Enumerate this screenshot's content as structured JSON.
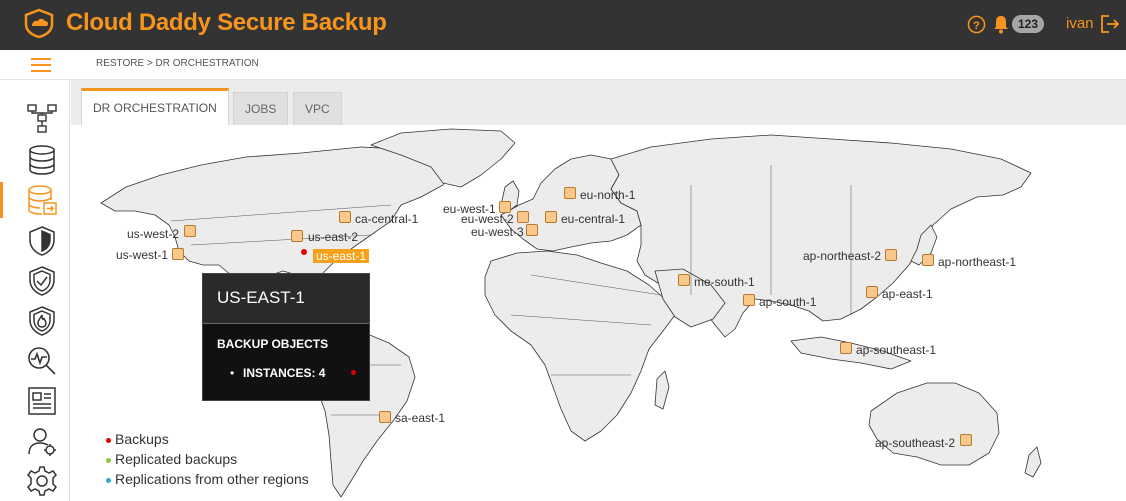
{
  "app": {
    "title": "Cloud Daddy Secure Backup",
    "accent_color": "#f7941d",
    "header_bg": "#333333"
  },
  "header": {
    "help_icon": "help-circle-icon",
    "bell_icon": "bell-icon",
    "notification_count": "123",
    "username": "ivan",
    "logout_icon": "logout-icon"
  },
  "breadcrumb": "RESTORE > DR ORCHESTRATION",
  "sidebar": {
    "items": [
      {
        "icon": "network-icon",
        "active": false
      },
      {
        "icon": "database-icon",
        "active": false
      },
      {
        "icon": "database-restore-icon",
        "active": true
      },
      {
        "icon": "shield-icon",
        "active": false
      },
      {
        "icon": "shield-check-icon",
        "active": false
      },
      {
        "icon": "shield-fire-icon",
        "active": false
      },
      {
        "icon": "monitor-search-icon",
        "active": false
      },
      {
        "icon": "report-icon",
        "active": false
      },
      {
        "icon": "user-admin-icon",
        "active": false
      },
      {
        "icon": "gear-icon",
        "active": false
      }
    ]
  },
  "tabs": [
    {
      "label": "DR ORCHESTRATION",
      "active": true
    },
    {
      "label": "JOBS",
      "active": false
    },
    {
      "label": "VPC",
      "active": false
    }
  ],
  "regions": [
    {
      "id": "us-west-2",
      "label": "us-west-2"
    },
    {
      "id": "us-west-1",
      "label": "us-west-1"
    },
    {
      "id": "ca-central-1",
      "label": "ca-central-1"
    },
    {
      "id": "us-east-2",
      "label": "us-east-2"
    },
    {
      "id": "us-east-1",
      "label": "us-east-1",
      "highlighted": true
    },
    {
      "id": "sa-east-1",
      "label": "sa-east-1"
    },
    {
      "id": "eu-north-1",
      "label": "eu-north-1"
    },
    {
      "id": "eu-west-1",
      "label": "eu-west-1"
    },
    {
      "id": "eu-west-2",
      "label": "eu-west-2"
    },
    {
      "id": "eu-central-1",
      "label": "eu-central-1"
    },
    {
      "id": "eu-west-3",
      "label": "eu-west-3"
    },
    {
      "id": "me-south-1",
      "label": "me-south-1"
    },
    {
      "id": "ap-south-1",
      "label": "ap-south-1"
    },
    {
      "id": "ap-northeast-2",
      "label": "ap-northeast-2"
    },
    {
      "id": "ap-northeast-1",
      "label": "ap-northeast-1"
    },
    {
      "id": "ap-east-1",
      "label": "ap-east-1"
    },
    {
      "id": "ap-southeast-1",
      "label": "ap-southeast-1"
    },
    {
      "id": "ap-southeast-2",
      "label": "ap-southeast-2"
    }
  ],
  "tooltip": {
    "title": "US-EAST-1",
    "subtitle": "BACKUP OBJECTS",
    "bullet": "•",
    "item": "INSTANCES: 4"
  },
  "legend": [
    {
      "label": "Backups",
      "color": "#e00000"
    },
    {
      "label": "Replicated backups",
      "color": "#8dc63f"
    },
    {
      "label": "Replications from other regions",
      "color": "#29abe2"
    }
  ]
}
